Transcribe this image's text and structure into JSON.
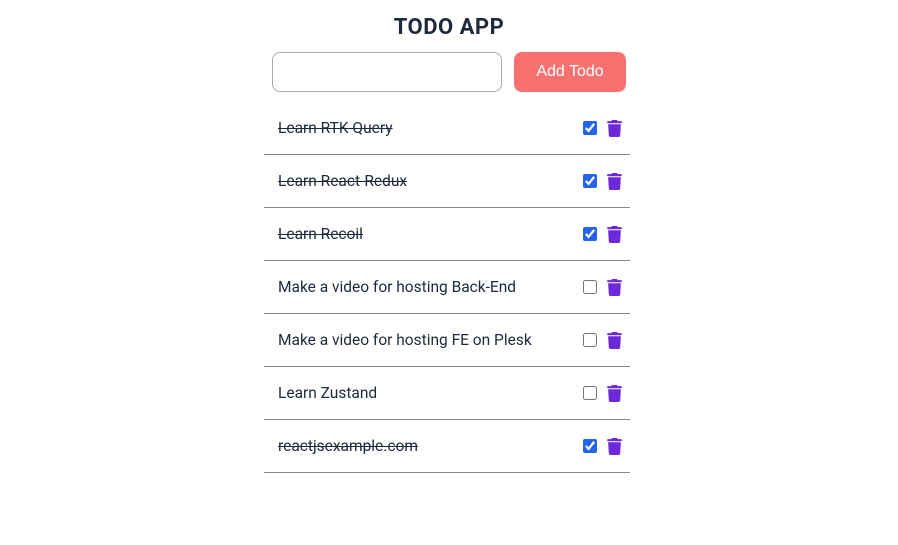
{
  "title": "TODO APP",
  "input": {
    "value": "",
    "placeholder": ""
  },
  "addButton": "Add Todo",
  "todos": [
    {
      "text": "Learn RTK Query",
      "done": true
    },
    {
      "text": "Learn React-Redux",
      "done": true
    },
    {
      "text": "Learn Recoil",
      "done": true
    },
    {
      "text": "Make a video for hosting Back-End",
      "done": false
    },
    {
      "text": "Make a video for hosting FE on Plesk",
      "done": false
    },
    {
      "text": "Learn Zustand",
      "done": false
    },
    {
      "text": "reactjsexample.com",
      "done": true
    }
  ]
}
